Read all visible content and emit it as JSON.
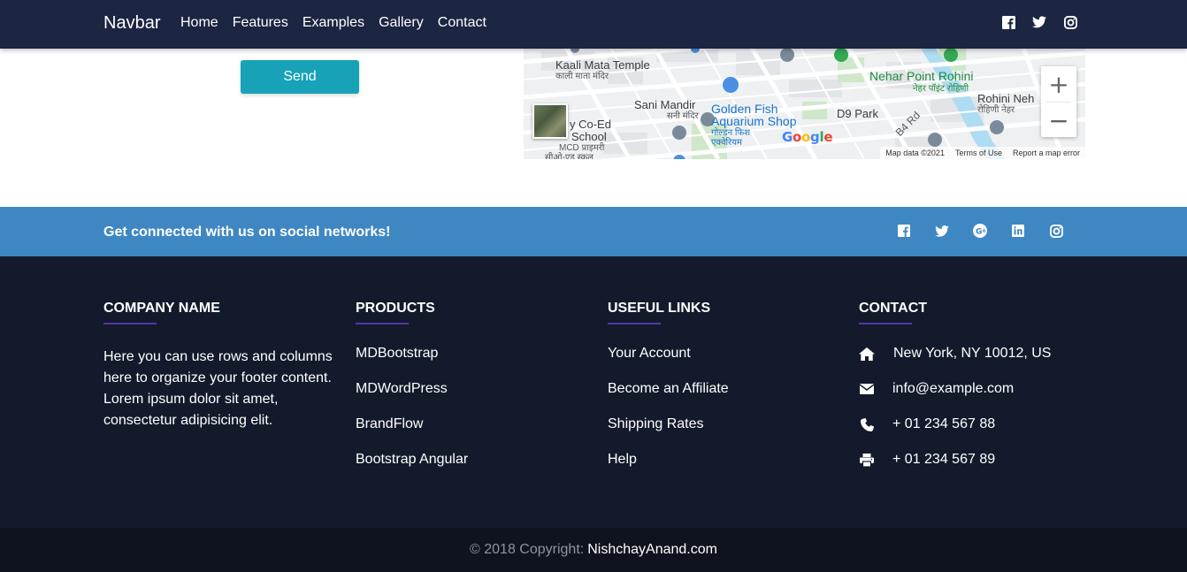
{
  "navbar": {
    "brand": "Navbar",
    "links": [
      "Home",
      "Features",
      "Examples",
      "Gallery",
      "Contact"
    ],
    "icons": [
      "facebook-icon",
      "twitter-icon",
      "instagram-icon"
    ]
  },
  "form": {
    "send_label": "Send"
  },
  "map": {
    "labels": {
      "kaali": "Kaali Mata Temple",
      "kaali_hi": "काली माता मंदिर",
      "sani": "Sani Mandir",
      "sani_hi": "सनी मंदिर",
      "golden1": "Golden Fish",
      "golden2": "Aquarium Shop",
      "golden_hi1": "गोल्डन फिश",
      "golden_hi2": "एक्वेरियम",
      "nehar": "Nehar Point Rohini",
      "nehar_hi": "नेहर पॉइंट रोहिणी",
      "rohini": "Rohini Neh",
      "rohini_hi": "रोहिणी नेहर",
      "d9": "D9 Park",
      "b4": "B4 Rd",
      "school1": "y Co-Ed",
      "school2": "School",
      "school_hi1": "MCD प्राइमरी",
      "school_hi2": "सीओ-एड स्कूल"
    },
    "google": "Google",
    "map_data": "Map data ©2021",
    "terms": "Terms of Use",
    "report": "Report a map error",
    "zoom_in": "+",
    "zoom_out": "−"
  },
  "social_bar": {
    "text": "Get connected with us on social networks!",
    "icons": [
      "facebook-icon",
      "twitter-icon",
      "google-plus-icon",
      "linkedin-icon",
      "instagram-icon"
    ]
  },
  "footer": {
    "company": {
      "title": "COMPANY NAME",
      "text": "Here you can use rows and columns here to organize your footer content. Lorem ipsum dolor sit amet, consectetur adipisicing elit."
    },
    "products": {
      "title": "PRODUCTS",
      "items": [
        "MDBootstrap",
        "MDWordPress",
        "BrandFlow",
        "Bootstrap Angular"
      ]
    },
    "useful_links": {
      "title": "USEFUL LINKS",
      "items": [
        "Your Account",
        "Become an Affiliate",
        "Shipping Rates",
        "Help"
      ]
    },
    "contact": {
      "title": "CONTACT",
      "address": "New York, NY 10012, US",
      "email": "info@example.com",
      "phone": "+ 01 234 567 88",
      "fax": "+ 01 234 567 89"
    },
    "accent_color": "#5a34b0"
  },
  "copyright": {
    "prefix": "© 2018 Copyright:",
    "link": "NishchayAnand.com"
  },
  "colors": {
    "navbar": "#1c2541",
    "social_bar": "#3f87c3",
    "footer": "#131a2b",
    "copyright_bg": "#0e131f",
    "send_button": "#17a2b8"
  }
}
